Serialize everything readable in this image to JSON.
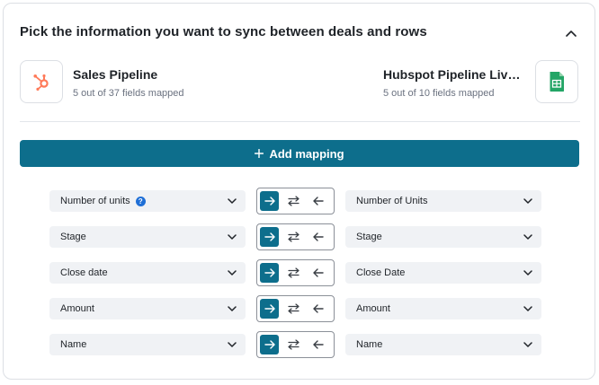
{
  "header": {
    "title": "Pick the information you want to sync between deals and rows"
  },
  "source_left": {
    "icon": "hubspot-icon",
    "name": "Sales Pipeline",
    "subtitle": "5 out of 37 fields mapped"
  },
  "source_right": {
    "icon": "google-sheets-icon",
    "name": "Hubspot Pipeline Live D...",
    "subtitle": "5 out of 10 fields mapped"
  },
  "add_mapping": {
    "label": "Add mapping"
  },
  "mappings": [
    {
      "left": "Number of units",
      "right": "Number of Units",
      "direction": "right",
      "help": "?"
    },
    {
      "left": "Stage",
      "right": "Stage",
      "direction": "right"
    },
    {
      "left": "Close date",
      "right": "Close Date",
      "direction": "right"
    },
    {
      "left": "Amount",
      "right": "Amount",
      "direction": "right"
    },
    {
      "left": "Name",
      "right": "Name",
      "direction": "right"
    }
  ],
  "colors": {
    "accent": "#0d6e8c",
    "hubspot": "#ff7a59",
    "sheets": "#23a566",
    "help": "#1f6fd6"
  }
}
